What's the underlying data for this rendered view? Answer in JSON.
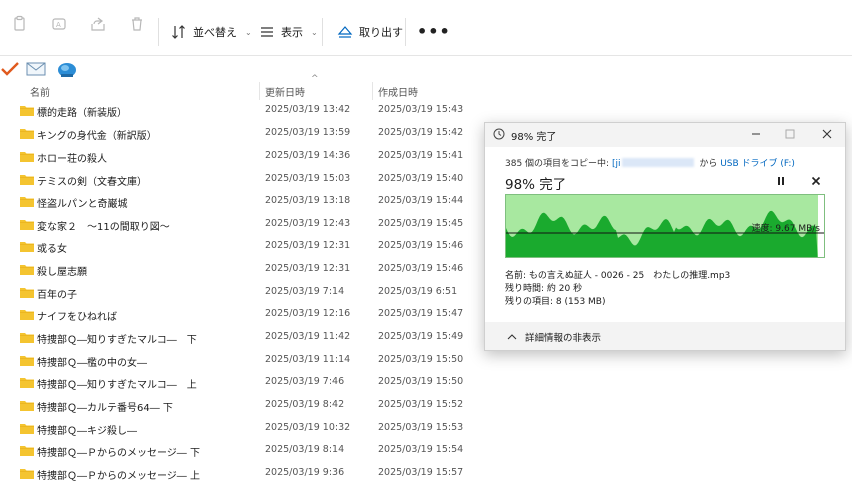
{
  "toolbar": {
    "sort_label": "並べ替え",
    "view_label": "表示",
    "eject_label": "取り出す",
    "more_label": "•••"
  },
  "columns": {
    "name": "名前",
    "modified": "更新日時",
    "created": "作成日時"
  },
  "files": [
    {
      "name": "標的走路（新装版）",
      "modified": "2025/03/19 13:42",
      "created": "2025/03/19 15:43"
    },
    {
      "name": "キングの身代金（新訳版）",
      "modified": "2025/03/19 13:59",
      "created": "2025/03/19 15:42"
    },
    {
      "name": "ホロー荘の殺人",
      "modified": "2025/03/19 14:36",
      "created": "2025/03/19 15:41"
    },
    {
      "name": "テミスの剣（文春文庫）",
      "modified": "2025/03/19 15:03",
      "created": "2025/03/19 15:40"
    },
    {
      "name": "怪盗ルパンと奇巌城",
      "modified": "2025/03/19 13:18",
      "created": "2025/03/19 15:44"
    },
    {
      "name": "変な家２　～11の間取り図～",
      "modified": "2025/03/19 12:43",
      "created": "2025/03/19 15:45"
    },
    {
      "name": "或る女",
      "modified": "2025/03/19 12:31",
      "created": "2025/03/19 15:46"
    },
    {
      "name": "殺し屋志願",
      "modified": "2025/03/19 12:31",
      "created": "2025/03/19 15:46"
    },
    {
      "name": "百年の子",
      "modified": "2025/03/19 7:14",
      "created": "2025/03/19 6:51"
    },
    {
      "name": "ナイフをひねれば",
      "modified": "2025/03/19 12:16",
      "created": "2025/03/19 15:47"
    },
    {
      "name": "特捜部Ｑ―知りすぎたマルコ―　下",
      "modified": "2025/03/19 11:42",
      "created": "2025/03/19 15:49"
    },
    {
      "name": "特捜部Ｑ―檻の中の女―",
      "modified": "2025/03/19 11:14",
      "created": "2025/03/19 15:50"
    },
    {
      "name": "特捜部Ｑ―知りすぎたマルコ―　上",
      "modified": "2025/03/19 7:46",
      "created": "2025/03/19 15:50"
    },
    {
      "name": "特捜部Ｑ―カルテ番号64― 下",
      "modified": "2025/03/19 8:42",
      "created": "2025/03/19 15:52"
    },
    {
      "name": "特捜部Ｑ―キジ殺し―",
      "modified": "2025/03/19 10:32",
      "created": "2025/03/19 15:53"
    },
    {
      "name": "特捜部Ｑ―Ｐからのメッセージ― 下",
      "modified": "2025/03/19 8:14",
      "created": "2025/03/19 15:54"
    },
    {
      "name": "特捜部Ｑ―Ｐからのメッセージ― 上",
      "modified": "2025/03/19 9:36",
      "created": "2025/03/19 15:57"
    }
  ],
  "dialog": {
    "title": "98% 完了",
    "copy_prefix": "385 個の項目をコピー中: ",
    "source_start": "[ji",
    "copy_mid": " から ",
    "destination": "USB ドライブ (F:)",
    "percent_text": "98% 完了",
    "progress_percent": 98,
    "speed": "速度: 9.67 MB/s",
    "name_line": "名前: もの言えぬ証人 - 0026 - 25　わたしの推理.mp3",
    "time_line": "残り時間: 約 20 秒",
    "items_line": "残りの項目: 8 (153 MB)",
    "collapse_label": "詳細情報の非表示"
  },
  "colors": {
    "graph_fill": "#1aaa2e",
    "graph_bg": "#a8e8a0",
    "link": "#0067c0",
    "folder": "#f4c430"
  }
}
